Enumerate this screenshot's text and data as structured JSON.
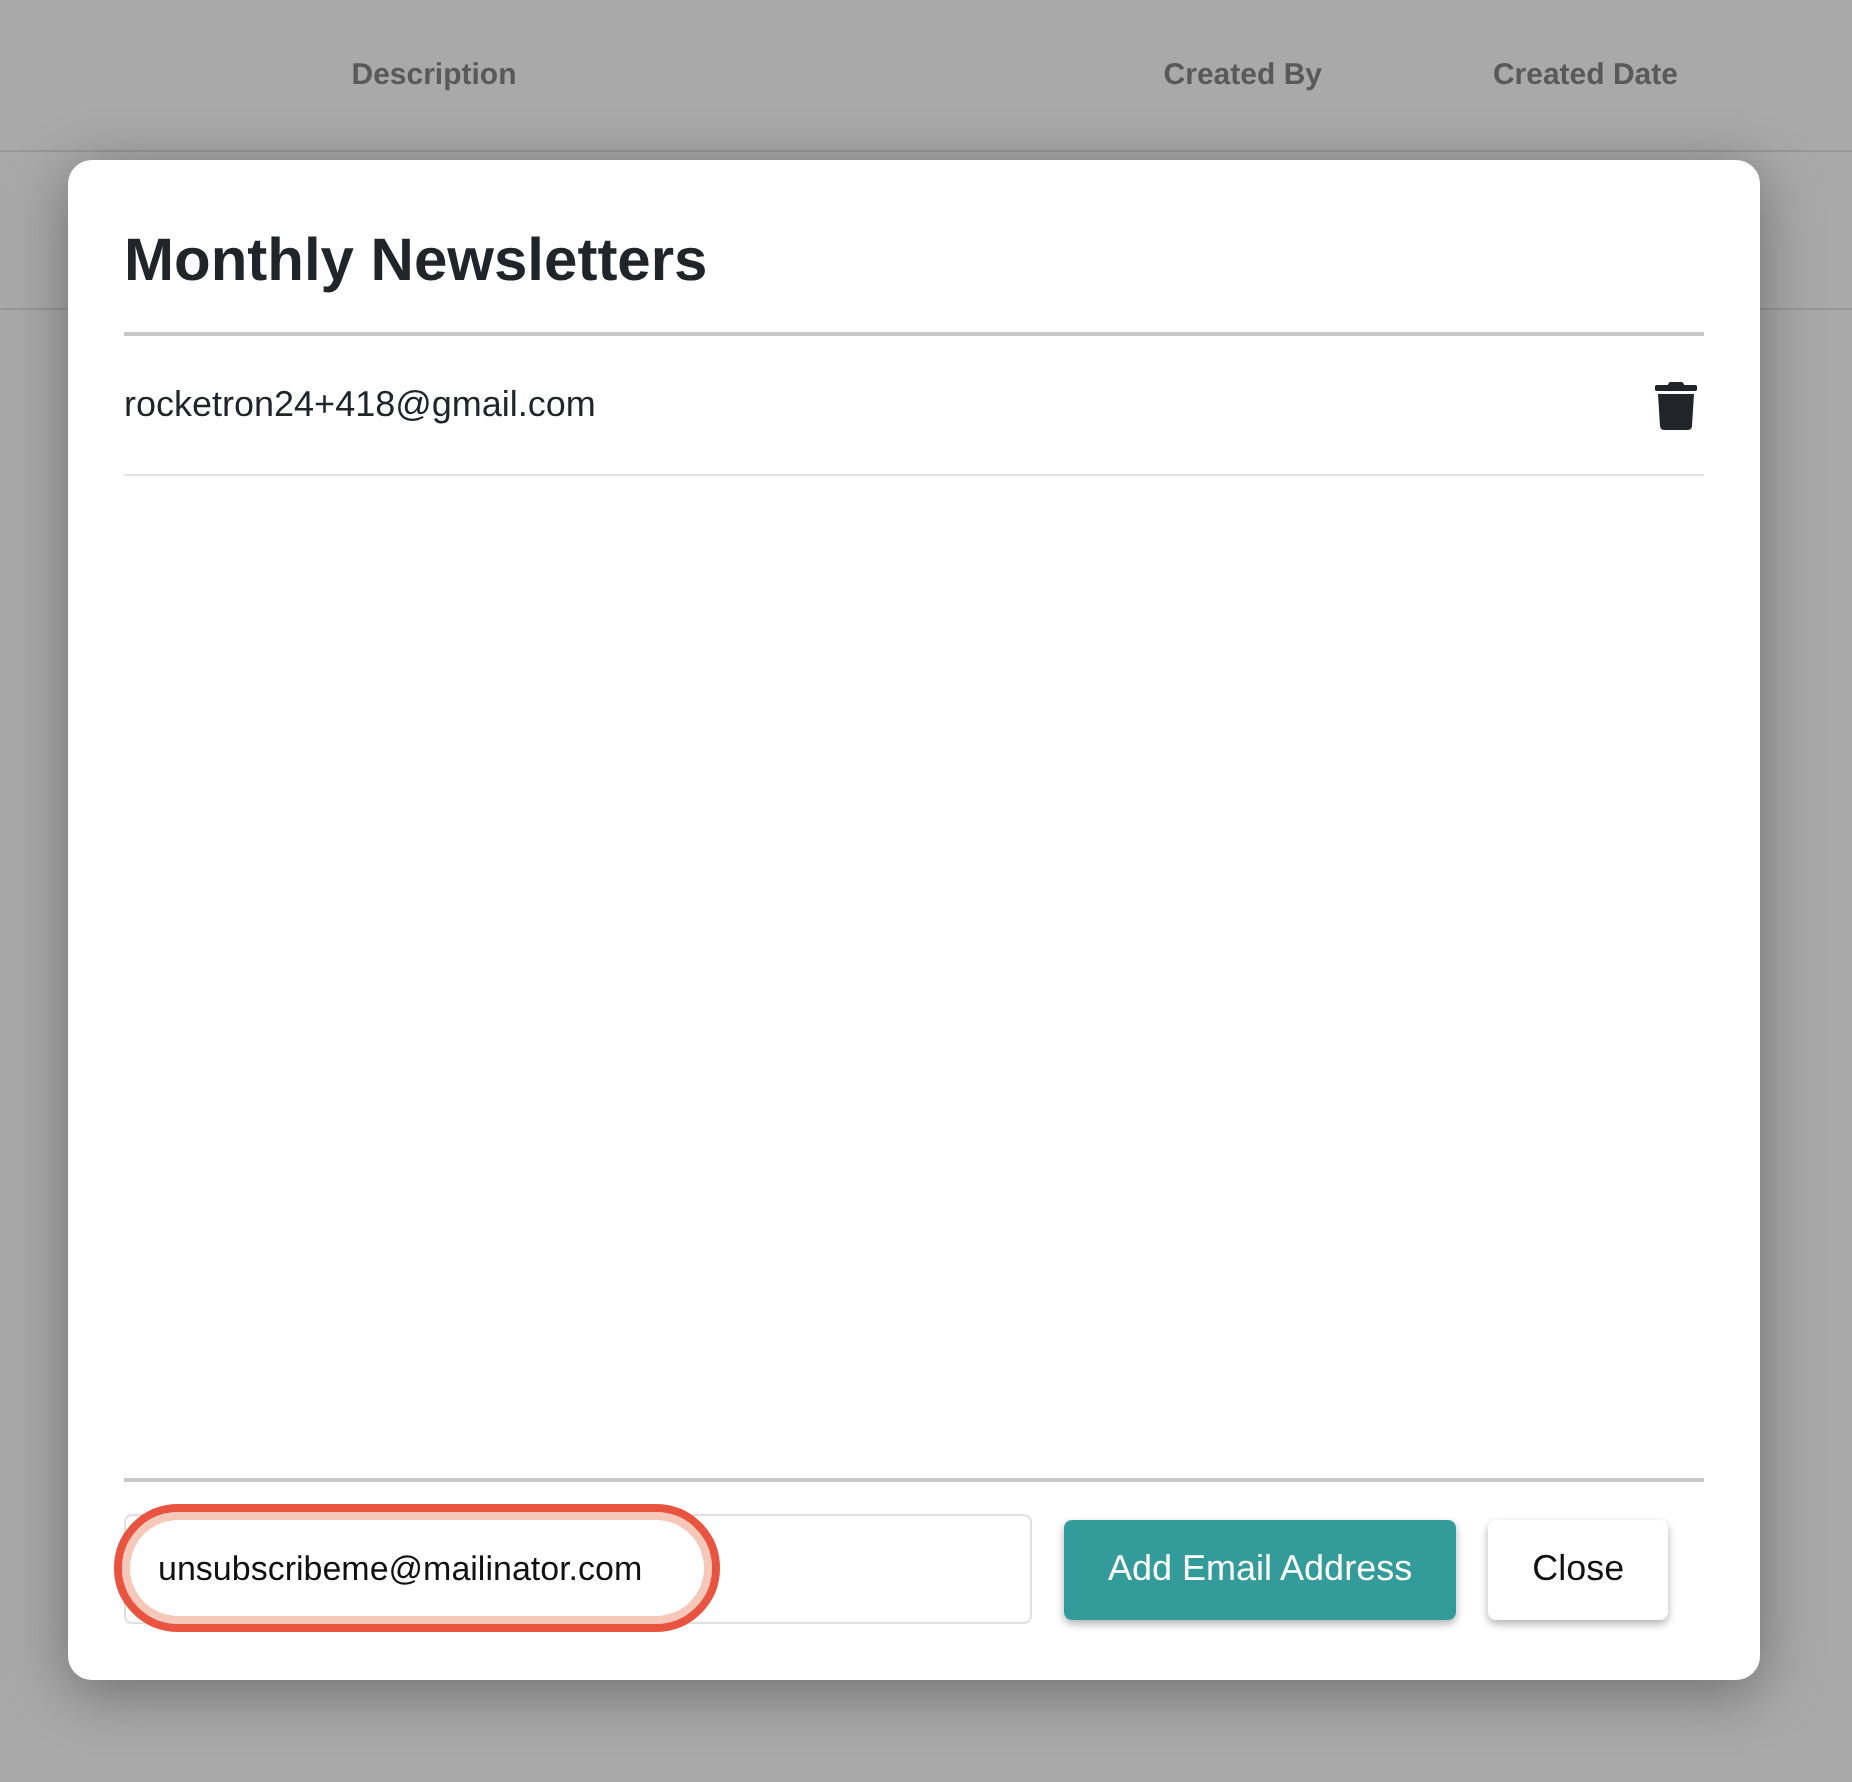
{
  "table": {
    "columns": [
      "Description",
      "Created By",
      "Created Date"
    ]
  },
  "dialog": {
    "title": "Monthly Newsletters",
    "emails": [
      {
        "address": "rocketron24+418@gmail.com"
      }
    ],
    "new_email": {
      "value": "unsubscribeme@mailinator.com",
      "highlighted": true
    },
    "buttons": [
      {
        "label": "Add Email Address",
        "kind": "primary"
      },
      {
        "label": "Close",
        "kind": "secondary"
      }
    ]
  }
}
